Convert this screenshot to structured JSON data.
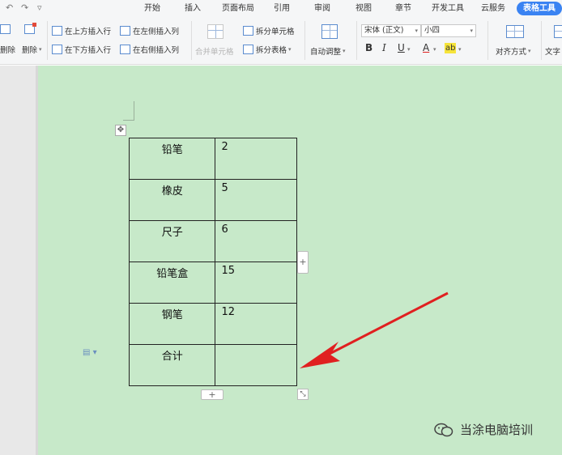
{
  "quick_access": {
    "undo": "↶",
    "redo": "↷",
    "customize": "▿"
  },
  "tabs": [
    "开始",
    "插入",
    "页面布局",
    "引用",
    "审阅",
    "视图",
    "章节",
    "开发工具",
    "云服务",
    "表格工具"
  ],
  "active_tab": "表格工具",
  "ribbon": {
    "delete_cells_partial": "删除",
    "delete": "删除",
    "insert_row_above": "在上方插入行",
    "insert_row_below": "在下方插入行",
    "insert_col_left": "在左侧插入列",
    "insert_col_right": "在右侧插入列",
    "merge_cells": "合并单元格",
    "split_cells": "拆分单元格",
    "split_table": "拆分表格",
    "auto_fit": "自动调整",
    "font_name": "宋体 (正文)",
    "font_size": "小四",
    "bold": "B",
    "italic": "I",
    "underline": "U",
    "font_color": "A",
    "highlight": "ab",
    "align": "对齐方式",
    "text_direction": "文字"
  },
  "table": {
    "rows": [
      [
        "铅笔",
        "2"
      ],
      [
        "橡皮",
        "5"
      ],
      [
        "尺子",
        "6"
      ],
      [
        "铅笔盒",
        "15"
      ],
      [
        "钢笔",
        "12"
      ],
      [
        "合计",
        ""
      ]
    ]
  },
  "handles": {
    "add": "+",
    "move": "✥",
    "resize": "⤡"
  },
  "watermark": {
    "text": "当涂电脑培训"
  },
  "colors": {
    "page_background": "#c7e9c9",
    "active_tab": "#3a83f2",
    "arrow": "#e02020"
  }
}
